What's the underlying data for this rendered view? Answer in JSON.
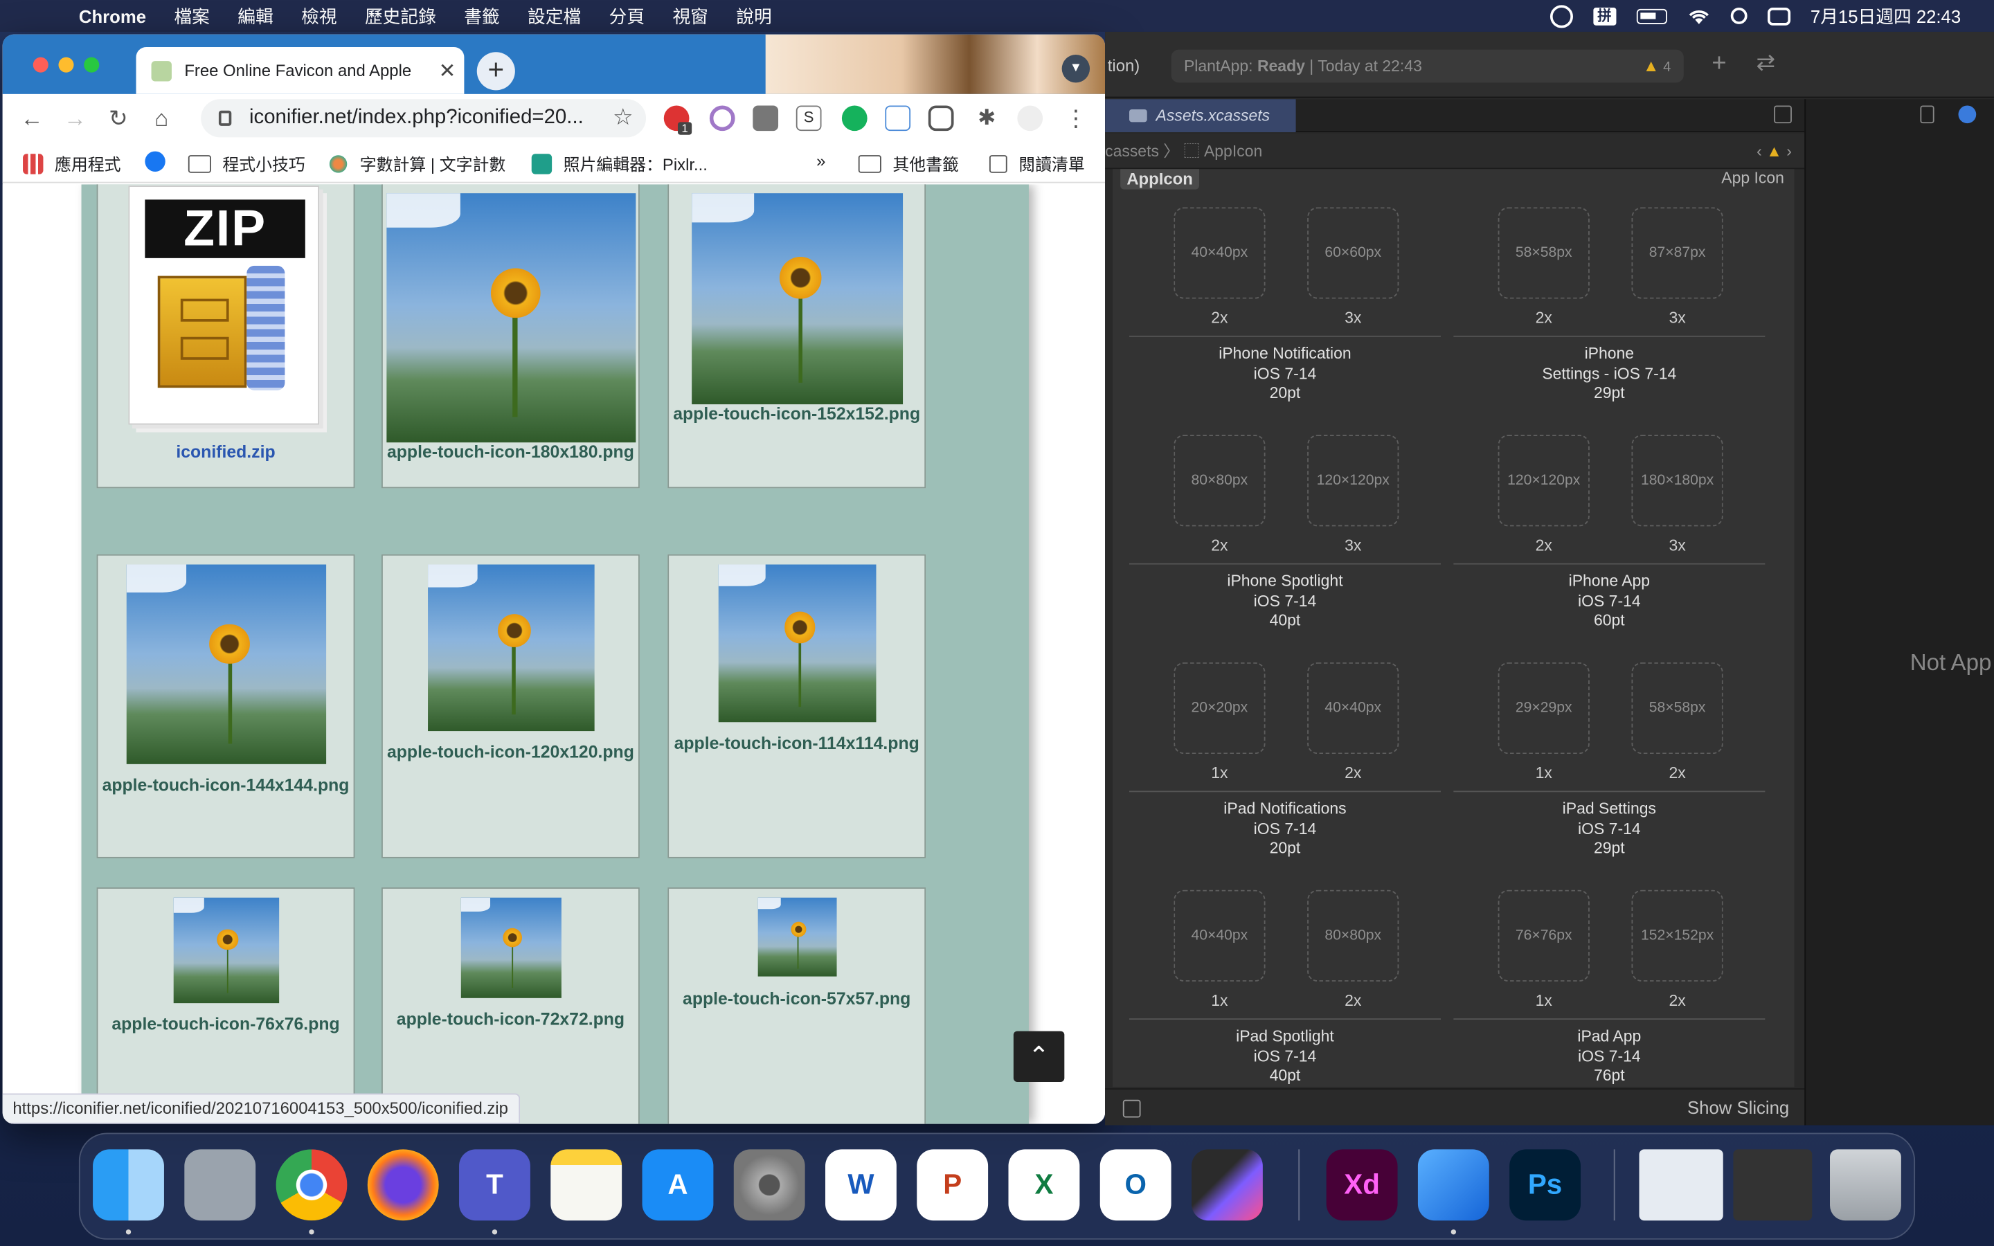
{
  "menubar": {
    "app": "Chrome",
    "items": [
      "檔案",
      "編輯",
      "檢視",
      "歷史記錄",
      "書籤",
      "設定檔",
      "分頁",
      "視窗",
      "說明"
    ],
    "clock": "7月15日週四  22:43"
  },
  "chrome": {
    "tab_title": "Free Online Favicon and Apple",
    "url": "iconifier.net/index.php?iconified=20...",
    "bookmarks": [
      "應用程式",
      "程式小技巧",
      "字數計算 | 文字計數",
      "照片編輯器：Pixlr...",
      "»",
      "其他書籤",
      "閱讀清單"
    ],
    "status_url": "https://iconifier.net/iconified/20210716004153_500x500/iconified.zip",
    "ext_badge": "1",
    "cards": [
      {
        "label": "iconified.zip"
      },
      {
        "label": "apple-touch-icon-180x180.png"
      },
      {
        "label": "apple-touch-icon-152x152.png"
      },
      {
        "label": "apple-touch-icon-144x144.png"
      },
      {
        "label": "apple-touch-icon-120x120.png"
      },
      {
        "label": "apple-touch-icon-114x114.png"
      },
      {
        "label": "apple-touch-icon-76x76.png"
      },
      {
        "label": "apple-touch-icon-72x72.png"
      },
      {
        "label": "apple-touch-icon-57x57.png"
      }
    ],
    "zip_text": "ZIP"
  },
  "xcode": {
    "scheme_tail": "tion)",
    "activity_app": "PlantApp:",
    "activity_state": "Ready",
    "activity_time": "| Today at 22:43",
    "warning_count": "4",
    "tab": "Assets.xcassets",
    "jump": "cassets 〉 ⬚ AppIcon",
    "editor_title": "AppIcon",
    "editor_kind": "App Icon",
    "groups": [
      {
        "slots": [
          "40×40px",
          "60×60px"
        ],
        "scales": [
          "2x",
          "3x"
        ],
        "lines": [
          "iPhone Notification",
          "iOS 7-14",
          "20pt"
        ]
      },
      {
        "slots": [
          "58×58px",
          "87×87px"
        ],
        "scales": [
          "2x",
          "3x"
        ],
        "lines": [
          "iPhone",
          "Settings - iOS 7-14",
          "29pt"
        ]
      },
      {
        "slots": [
          "80×80px",
          "120×120px"
        ],
        "scales": [
          "2x",
          "3x"
        ],
        "lines": [
          "iPhone Spotlight",
          "iOS 7-14",
          "40pt"
        ]
      },
      {
        "slots": [
          "120×120px",
          "180×180px"
        ],
        "scales": [
          "2x",
          "3x"
        ],
        "lines": [
          "iPhone App",
          "iOS 7-14",
          "60pt"
        ]
      },
      {
        "slots": [
          "20×20px",
          "40×40px"
        ],
        "scales": [
          "1x",
          "2x"
        ],
        "lines": [
          "iPad Notifications",
          "iOS 7-14",
          "20pt"
        ]
      },
      {
        "slots": [
          "29×29px",
          "58×58px"
        ],
        "scales": [
          "1x",
          "2x"
        ],
        "lines": [
          "iPad Settings",
          "iOS 7-14",
          "29pt"
        ]
      },
      {
        "slots": [
          "40×40px",
          "80×80px"
        ],
        "scales": [
          "1x",
          "2x"
        ],
        "lines": [
          "iPad Spotlight",
          "iOS 7-14",
          "40pt"
        ]
      },
      {
        "slots": [
          "76×76px",
          "152×152px"
        ],
        "scales": [
          "1x",
          "2x"
        ],
        "lines": [
          "iPad App",
          "iOS 7-14",
          "76pt"
        ]
      }
    ],
    "bottom": "Show Slicing",
    "inspector_text": "Not App"
  },
  "dock": {
    "apps": [
      "finder-icon",
      "launchpad-icon",
      "chrome-icon",
      "firefox-icon",
      "teams-icon",
      "notes-icon",
      "app-store-icon",
      "system-preferences-icon",
      "word-icon",
      "powerpoint-icon",
      "excel-icon",
      "outlook-icon",
      "final-cut-icon",
      "xd-icon",
      "xcode-icon",
      "photoshop-icon",
      "window-preview-1",
      "window-preview-2",
      "trash-icon"
    ],
    "labels": {
      "word": "W",
      "powerpoint": "P",
      "excel": "X",
      "outlook": "O",
      "teams": "T",
      "xd": "Xd",
      "ps": "Ps"
    }
  }
}
